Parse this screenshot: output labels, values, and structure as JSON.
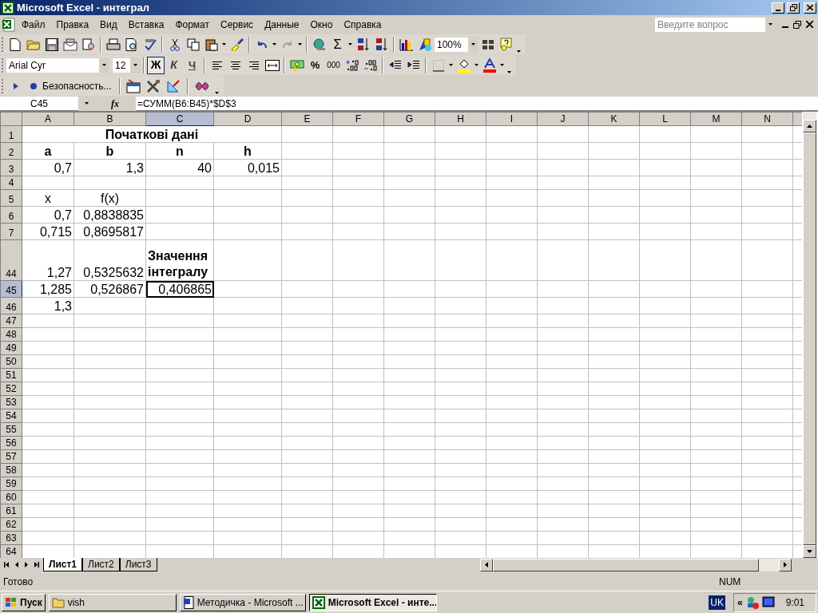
{
  "window": {
    "title": "Microsoft Excel - интеграл"
  },
  "menu": [
    "Файл",
    "Правка",
    "Вид",
    "Вставка",
    "Формат",
    "Сервис",
    "Данные",
    "Окно",
    "Справка"
  ],
  "help_box": {
    "placeholder": "Введите вопрос"
  },
  "standard_toolbar": {
    "sum_symbol": "Σ",
    "zoom": "100%"
  },
  "format_toolbar": {
    "font": "Arial Cyr",
    "size": "12",
    "bold": "Ж",
    "italic": "К",
    "underline": "Ч",
    "percent": "%",
    "thousands": "000"
  },
  "security_toolbar": {
    "label": "Безопасность..."
  },
  "formula_bar": {
    "name_box": "C45",
    "function_label": "fx",
    "formula": "=СУММ(B6:B45)*$D$3"
  },
  "columns": [
    {
      "label": "A",
      "selected": false
    },
    {
      "label": "B",
      "selected": false
    },
    {
      "label": "C",
      "selected": true
    },
    {
      "label": "D",
      "selected": false
    },
    {
      "label": "E",
      "selected": false
    },
    {
      "label": "F",
      "selected": false
    },
    {
      "label": "G",
      "selected": false
    },
    {
      "label": "H",
      "selected": false
    },
    {
      "label": "I",
      "selected": false
    },
    {
      "label": "J",
      "selected": false
    },
    {
      "label": "K",
      "selected": false
    },
    {
      "label": "L",
      "selected": false
    },
    {
      "label": "M",
      "selected": false
    },
    {
      "label": "N",
      "selected": false
    }
  ],
  "rows": [
    {
      "number": "1",
      "selected": false,
      "cells": [
        {
          "kind": "title",
          "text": "Початкові дані",
          "selected": false
        }
      ]
    },
    {
      "number": "2",
      "selected": false,
      "cells": [
        {
          "kind": "heading",
          "text": "a",
          "selected": false
        },
        {
          "kind": "heading",
          "text": "b",
          "selected": false
        },
        {
          "kind": "heading",
          "text": "n",
          "selected": false
        },
        {
          "kind": "heading",
          "text": "h",
          "selected": false
        }
      ]
    },
    {
      "number": "3",
      "selected": false,
      "cells": [
        {
          "kind": "number",
          "text": "0,7",
          "selected": false
        },
        {
          "kind": "number",
          "text": "1,3",
          "selected": false
        },
        {
          "kind": "number",
          "text": "40",
          "selected": false
        },
        {
          "kind": "number",
          "text": "0,015",
          "selected": false
        }
      ]
    },
    {
      "number": "4",
      "selected": false,
      "cells": []
    },
    {
      "number": "5",
      "selected": false,
      "cells": [
        {
          "kind": "label",
          "text": "x",
          "selected": false
        },
        {
          "kind": "label",
          "text": "f(x)",
          "selected": false
        }
      ]
    },
    {
      "number": "6",
      "selected": false,
      "cells": [
        {
          "kind": "number",
          "text": "0,7",
          "selected": false
        },
        {
          "kind": "number",
          "text": "0,8838835",
          "selected": false
        }
      ]
    },
    {
      "number": "7",
      "selected": false,
      "cells": [
        {
          "kind": "number",
          "text": "0,715",
          "selected": false
        },
        {
          "kind": "number",
          "text": "0,8695817",
          "selected": false
        }
      ]
    },
    {
      "number": "44",
      "selected": false,
      "cells": [
        {
          "kind": "number",
          "text": "1,27",
          "selected": false
        },
        {
          "kind": "number",
          "text": "0,5325632",
          "selected": false
        },
        {
          "kind": "wrap",
          "text": "Значення інтегралу",
          "selected": false
        }
      ]
    },
    {
      "number": "45",
      "selected": true,
      "cells": [
        {
          "kind": "number",
          "text": "1,285",
          "selected": false
        },
        {
          "kind": "number",
          "text": "0,526867",
          "selected": false
        },
        {
          "kind": "number",
          "text": "0,406865",
          "selected": true
        }
      ]
    },
    {
      "number": "46",
      "selected": false,
      "cells": [
        {
          "kind": "number",
          "text": "1,3",
          "selected": false
        }
      ]
    },
    {
      "number": "47",
      "selected": false,
      "cells": []
    },
    {
      "number": "48",
      "selected": false,
      "cells": []
    },
    {
      "number": "49",
      "selected": false,
      "cells": []
    },
    {
      "number": "50",
      "selected": false,
      "cells": []
    },
    {
      "number": "51",
      "selected": false,
      "cells": []
    },
    {
      "number": "52",
      "selected": false,
      "cells": []
    },
    {
      "number": "53",
      "selected": false,
      "cells": []
    },
    {
      "number": "54",
      "selected": false,
      "cells": []
    },
    {
      "number": "55",
      "selected": false,
      "cells": []
    },
    {
      "number": "56",
      "selected": false,
      "cells": []
    },
    {
      "number": "57",
      "selected": false,
      "cells": []
    },
    {
      "number": "58",
      "selected": false,
      "cells": []
    },
    {
      "number": "59",
      "selected": false,
      "cells": []
    },
    {
      "number": "60",
      "selected": false,
      "cells": []
    },
    {
      "number": "61",
      "selected": false,
      "cells": []
    },
    {
      "number": "62",
      "selected": false,
      "cells": []
    },
    {
      "number": "63",
      "selected": false,
      "cells": []
    },
    {
      "number": "64",
      "selected": false,
      "cells": []
    }
  ],
  "sheet_tabs": [
    {
      "label": "Лист1",
      "selected": true
    },
    {
      "label": "Лист2",
      "selected": false
    },
    {
      "label": "Лист3",
      "selected": false
    }
  ],
  "status_bar": {
    "text": "Готово",
    "indicator": "NUM"
  },
  "taskbar": {
    "start": "Пуск",
    "tasks": [
      {
        "kind": "folder",
        "label": "vish",
        "selected": false
      },
      {
        "kind": "word",
        "label": "Методичка - Microsoft ...",
        "selected": false
      },
      {
        "kind": "excel",
        "label": "Microsoft Excel - инте...",
        "selected": true
      }
    ],
    "language": "UK",
    "tray_expand": "«",
    "clock": "9:01"
  }
}
